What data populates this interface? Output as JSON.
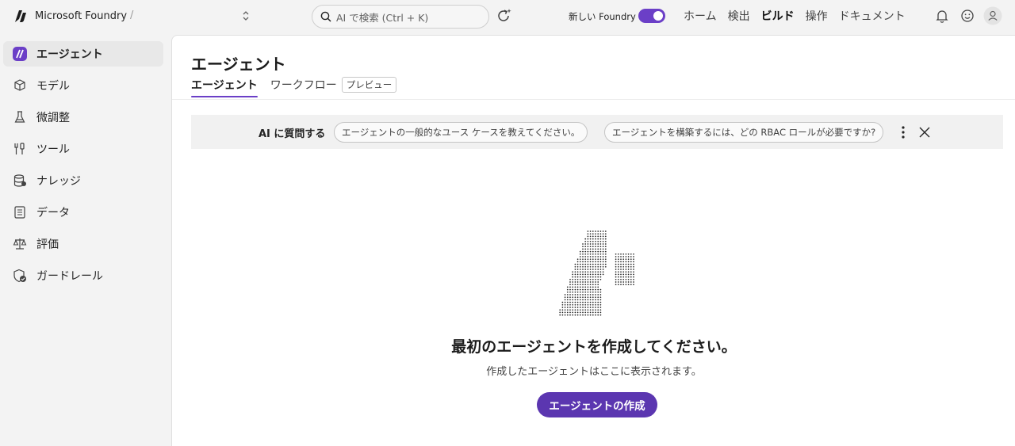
{
  "topbar": {
    "brand": "Microsoft Foundry",
    "separator": "/",
    "search_placeholder": "AI で検索 (Ctrl + K)",
    "new_foundry_label": "新しい Foundry",
    "new_foundry_enabled": true,
    "nav": [
      "ホーム",
      "検出",
      "ビルド",
      "操作",
      "ドキュメント"
    ],
    "nav_active": "ビルド"
  },
  "sidebar": {
    "items": [
      {
        "label": "エージェント",
        "icon": "agent-icon",
        "active": true
      },
      {
        "label": "モデル",
        "icon": "cube-icon",
        "active": false
      },
      {
        "label": "微調整",
        "icon": "flask-icon",
        "active": false
      },
      {
        "label": "ツール",
        "icon": "tools-icon",
        "active": false
      },
      {
        "label": "ナレッジ",
        "icon": "database-icon",
        "active": false
      },
      {
        "label": "データ",
        "icon": "document-icon",
        "active": false
      },
      {
        "label": "評価",
        "icon": "scale-icon",
        "active": false
      },
      {
        "label": "ガードレール",
        "icon": "shield-check-icon",
        "active": false
      }
    ]
  },
  "main": {
    "title": "エージェント",
    "tabs": [
      {
        "label": "エージェント",
        "active": true
      },
      {
        "label": "ワークフロー",
        "badge": "プレビュー",
        "active": false
      }
    ],
    "ask": {
      "label": "AI に質問する",
      "suggestions": [
        "エージェントの一般的なユース ケースを教えてください。",
        "エージェントを構築するには、どの RBAC ロールが必要ですか?"
      ]
    },
    "empty": {
      "title": "最初のエージェントを作成してください。",
      "subtitle": "作成したエージェントはここに表示されます。",
      "button": "エージェントの作成"
    }
  },
  "colors": {
    "accent": "#5b36b0",
    "toggle": "#6b3fc7",
    "background": "#f3f3f3"
  }
}
